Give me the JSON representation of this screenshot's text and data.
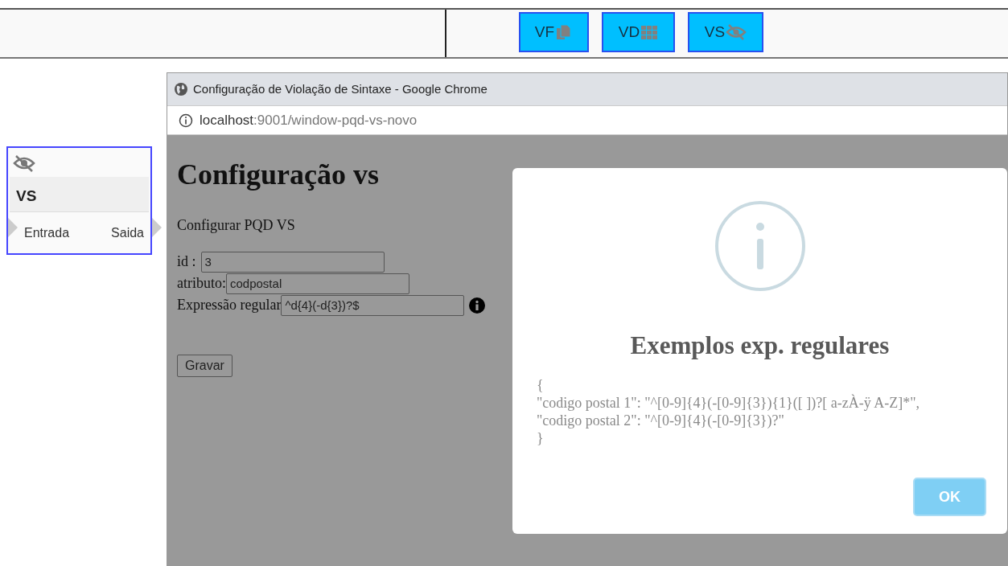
{
  "toolbar": {
    "buttons": [
      {
        "label": "VF",
        "kind": "files"
      },
      {
        "label": "VD",
        "kind": "grid"
      },
      {
        "label": "VS",
        "kind": "eye-slash"
      }
    ]
  },
  "node": {
    "title": "VS",
    "input": "Entrada",
    "output": "Saida"
  },
  "popup": {
    "title": "Configuração de Violação de Sintaxe - Google Chrome",
    "url_host": "localhost",
    "url_rest": ":9001/window-pqd-vs-novo",
    "heading": "Configuração vs",
    "subtitle": "Configurar PQD VS",
    "fields": [
      {
        "label": "id :",
        "value": "3",
        "info": false
      },
      {
        "label": "atributo:",
        "value": "codpostal",
        "info": false
      },
      {
        "label": "Expressão regular",
        "value": "^d{4}(-d{3})?$",
        "info": true
      }
    ],
    "save_button": "Gravar"
  },
  "dialog": {
    "title": "Exemplos exp. regulares",
    "lines": [
      "{",
      "\"codigo postal 1\": \"^[0-9]{4}(-[0-9]{3}){1}([ ])?[ a-zÀ-ÿ A-Z]*\",",
      "\"codigo postal 2\": \"^[0-9]{4}(-[0-9]{3})?\"",
      "}"
    ],
    "ok_button": "OK"
  }
}
